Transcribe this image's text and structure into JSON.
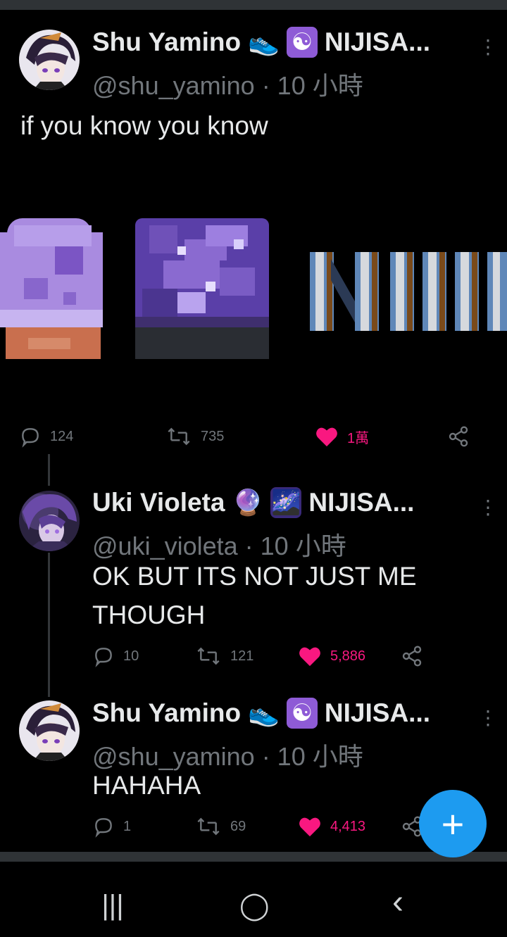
{
  "tweets": [
    {
      "name": "Shu Yamino",
      "emoji1": "👟",
      "emoji2": "☯",
      "org": "NIJISA...",
      "handle": "@shu_yamino",
      "time": "· 10 小時",
      "text": "if you know you know",
      "replies": "124",
      "retweets": "735",
      "likes": "1萬"
    },
    {
      "name": "Uki Violeta",
      "emoji1": "🔮",
      "emoji2": "🌌",
      "org": "NIJISA...",
      "handle": "@uki_violeta",
      "time": "· 10 小時",
      "text_line1": "OK BUT ITS NOT JUST ME",
      "text_line2": "THOUGH",
      "replies": "10",
      "retweets": "121",
      "likes": "5,886"
    },
    {
      "name": "Shu Yamino",
      "emoji1": "👟",
      "emoji2": "☯",
      "org": "NIJISA...",
      "handle": "@shu_yamino",
      "time": "· 10 小時",
      "text": "HAHAHA",
      "replies": "1",
      "retweets": "69",
      "likes": "4,413"
    }
  ],
  "fab": {
    "label": "+"
  },
  "navbar": {
    "recents": "|||",
    "home": "◯",
    "back": "‹"
  },
  "icons": {
    "reply": "reply-icon",
    "retweet": "retweet-icon",
    "like": "heart-icon",
    "share": "share-icon",
    "more": "more-icon"
  },
  "colors": {
    "accent": "#1d9bf0",
    "like": "#f91880",
    "muted": "#71767b"
  }
}
